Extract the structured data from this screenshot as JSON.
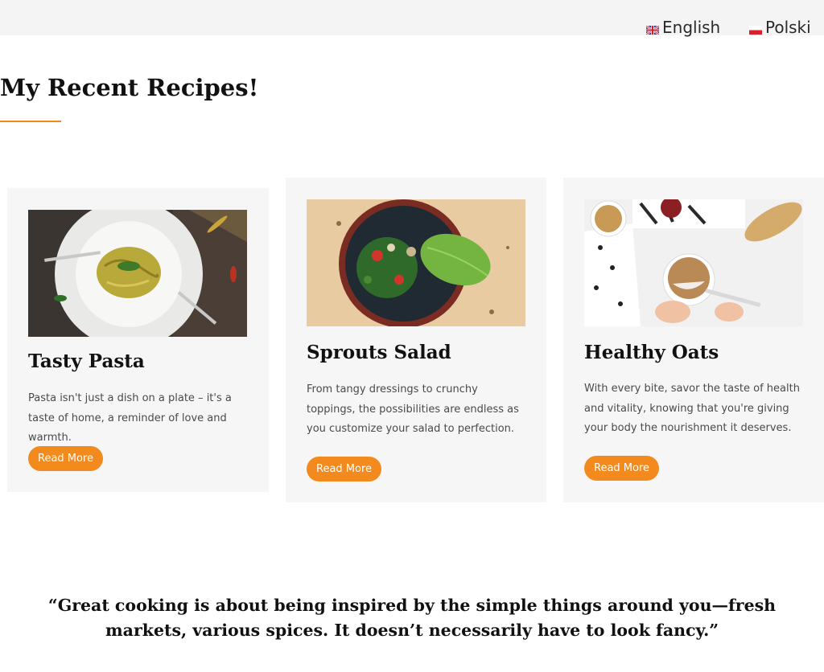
{
  "languages": [
    {
      "label": "English",
      "flag": "uk-flag-icon"
    },
    {
      "label": "Polski",
      "flag": "poland-flag-icon"
    }
  ],
  "section": {
    "title": "My Recent Recipes!",
    "accent_color": "#f0891a"
  },
  "recipes": [
    {
      "title": "Tasty Pasta",
      "description": "Pasta isn't just a dish on a plate – it's a taste of home, a reminder of love and warmth.",
      "button_label": "Read More",
      "image": "pasta-photo"
    },
    {
      "title": "Sprouts Salad",
      "description": "From tangy dressings to crunchy toppings, the possibilities are endless as you customize your salad to perfection.",
      "button_label": "Read More",
      "image": "salad-photo"
    },
    {
      "title": "Healthy Oats",
      "description": "With every bite, savor the taste of health and vitality, knowing that you're giving your body the nourishment it deserves.",
      "button_label": "Read More",
      "image": "oats-photo"
    }
  ],
  "quote": {
    "text": "“Great cooking is about being inspired by the simple things around you—fresh markets, various spices. It doesn’t necessarily have to look fancy.”"
  },
  "colors": {
    "button": "#f28a1d",
    "card_background": "#f6f6f6",
    "topbar_background": "#f4f4f4"
  }
}
